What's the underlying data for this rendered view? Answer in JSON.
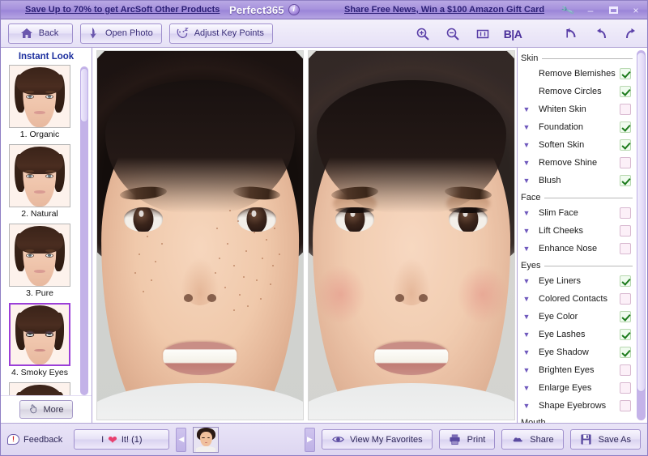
{
  "titlebar": {
    "promo_left": "Save Up to 70% to get ArcSoft Other Products",
    "app_title": "Perfect365",
    "info_icon": "info-icon",
    "promo_right": "Share Free News, Win a $100 Amazon Gift Card",
    "wrench_icon": "wrench-icon",
    "minimize": "–",
    "maximize": "maximize-icon",
    "close": "×"
  },
  "toolbar": {
    "back": "Back",
    "back_icon": "home-icon",
    "open_photo": "Open Photo",
    "open_photo_icon": "download-arrow-icon",
    "adjust_key_points": "Adjust Key Points",
    "adjust_icon": "face-points-icon",
    "zoom_in_icon": "zoom-in-icon",
    "zoom_out_icon": "zoom-out-icon",
    "fit_icon": "fit-to-window-icon",
    "before_after": "B|A",
    "reset_icon": "reset-icon",
    "undo_icon": "undo-icon",
    "redo_icon": "redo-icon"
  },
  "sidebar": {
    "title": "Instant Look",
    "looks": [
      {
        "label": "1. Organic",
        "selected": false,
        "style": "organic"
      },
      {
        "label": "2. Natural",
        "selected": false,
        "style": "natural"
      },
      {
        "label": "3. Pure",
        "selected": false,
        "style": "pure"
      },
      {
        "label": "4. Smoky Eyes",
        "selected": true,
        "style": "smoky"
      },
      {
        "label": "",
        "selected": false,
        "style": "partial"
      }
    ],
    "more_label": "More",
    "more_icon": "hand-pointer-icon"
  },
  "canvas": {
    "before_label": "before-photo",
    "after_label": "after-photo"
  },
  "rightpanel": {
    "groups": [
      {
        "name": "Skin",
        "options": [
          {
            "label": "Remove Blemishes",
            "checked": true,
            "expandable": false
          },
          {
            "label": "Remove Circles",
            "checked": true,
            "expandable": false
          },
          {
            "label": "Whiten Skin",
            "checked": false,
            "expandable": true
          },
          {
            "label": "Foundation",
            "checked": true,
            "expandable": true
          },
          {
            "label": "Soften Skin",
            "checked": true,
            "expandable": true
          },
          {
            "label": "Remove Shine",
            "checked": false,
            "expandable": true
          },
          {
            "label": "Blush",
            "checked": true,
            "expandable": true
          }
        ]
      },
      {
        "name": "Face",
        "options": [
          {
            "label": "Slim Face",
            "checked": false,
            "expandable": true
          },
          {
            "label": "Lift Cheeks",
            "checked": false,
            "expandable": true
          },
          {
            "label": "Enhance Nose",
            "checked": false,
            "expandable": true
          }
        ]
      },
      {
        "name": "Eyes",
        "options": [
          {
            "label": "Eye Liners",
            "checked": true,
            "expandable": true
          },
          {
            "label": "Colored Contacts",
            "checked": false,
            "expandable": true
          },
          {
            "label": "Eye Color",
            "checked": true,
            "expandable": true
          },
          {
            "label": "Eye Lashes",
            "checked": true,
            "expandable": true
          },
          {
            "label": "Eye Shadow",
            "checked": true,
            "expandable": true
          },
          {
            "label": "Brighten Eyes",
            "checked": false,
            "expandable": true
          },
          {
            "label": "Enlarge Eyes",
            "checked": false,
            "expandable": true
          },
          {
            "label": "Shape Eyebrows",
            "checked": false,
            "expandable": true
          }
        ]
      },
      {
        "name": "Mouth",
        "options": []
      }
    ]
  },
  "bottombar": {
    "feedback": "Feedback",
    "feedback_icon": "feedback-icon",
    "love_it": "I ♥ It! (1)",
    "love_it_prefix": "I",
    "love_it_suffix": "It! (1)",
    "heart_icon": "heart-icon",
    "prev_icon": "◀",
    "next_icon": "▶",
    "view_favorites": "View My Favorites",
    "view_favorites_icon": "eye-icon",
    "print": "Print",
    "print_icon": "printer-icon",
    "share": "Share",
    "share_icon": "cloud-icon",
    "save_as": "Save As",
    "save_as_icon": "floppy-disk-icon"
  },
  "colors": {
    "titlebar_purple": "#a793dd",
    "link_text": "#2b1f75",
    "selection_border": "#9b3fd8",
    "checkbox_on": "#f0fbef",
    "checkbox_off": "#fcf0f8",
    "check_mark": "#1b7a1b",
    "sidebar_title": "#1c2f9e",
    "heart_pink": "#e8416f"
  }
}
